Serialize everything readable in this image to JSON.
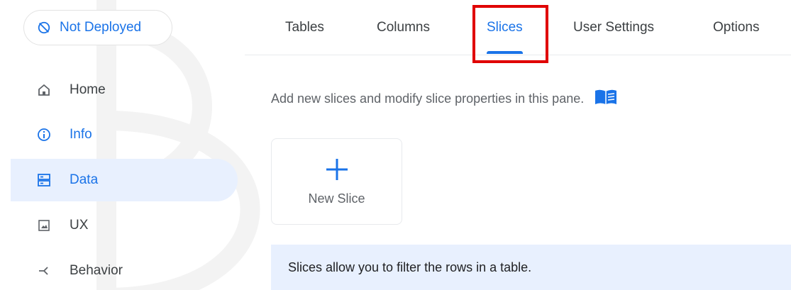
{
  "deploy_status": {
    "label": "Not Deployed",
    "icon": "not-deployed-icon"
  },
  "sidebar": {
    "items": [
      {
        "label": "Home",
        "icon": "home-icon"
      },
      {
        "label": "Info",
        "icon": "info-icon"
      },
      {
        "label": "Data",
        "icon": "data-icon"
      },
      {
        "label": "UX",
        "icon": "ux-icon"
      },
      {
        "label": "Behavior",
        "icon": "behavior-icon"
      }
    ]
  },
  "tabs": [
    {
      "label": "Tables"
    },
    {
      "label": "Columns"
    },
    {
      "label": "Slices"
    },
    {
      "label": "User Settings"
    },
    {
      "label": "Options"
    }
  ],
  "main": {
    "description": "Add new slices and modify slice properties in this pane.",
    "new_slice_label": "New Slice",
    "info_banner": "Slices allow you to filter the rows in a table."
  },
  "colors": {
    "accent": "#1a73e8",
    "active_bg": "#e8f0fe",
    "highlight": "#e00000"
  }
}
